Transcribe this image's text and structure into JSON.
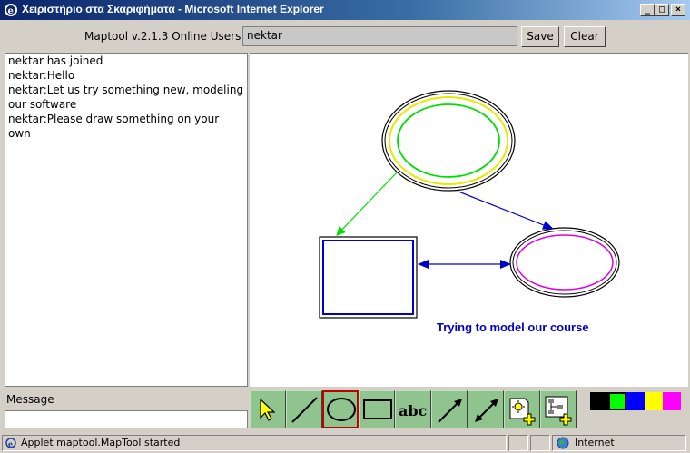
{
  "window": {
    "title": "Χειριστήριο στα Σκαριφήματα - Microsoft Internet Explorer",
    "minimize": "_",
    "maximize": "□",
    "close": "×"
  },
  "header": {
    "online_label": "Maptool v.2.1.3 Online Users",
    "users_value": "nektar",
    "save_label": "Save",
    "clear_label": "Clear"
  },
  "chat": {
    "lines": [
      "nektar has joined",
      "nektar:Hello",
      "nektar:Let us try something new, modeling",
      "our software",
      "nektar:Please draw something on your own"
    ]
  },
  "canvas": {
    "annotation": "Trying to model our course",
    "annotation_color": "#0000cc"
  },
  "message": {
    "label": "Message",
    "value": ""
  },
  "toolbar": {
    "tools": [
      "select-arrow-icon",
      "line-icon",
      "ellipse-icon",
      "rectangle-icon",
      "text-abc-icon",
      "arrow-icon",
      "double-arrow-icon",
      "add-node-icon",
      "add-tree-icon"
    ],
    "text_tool_label": "abc",
    "selected_tool": "ellipse-icon"
  },
  "palette": {
    "colors": [
      "#000000",
      "#00ff00",
      "#0000ff",
      "#ffff00",
      "#ff00ff"
    ],
    "selected": "#00ff00"
  },
  "status": {
    "text": "Applet maptool.MapTool started",
    "zone": "Internet"
  }
}
